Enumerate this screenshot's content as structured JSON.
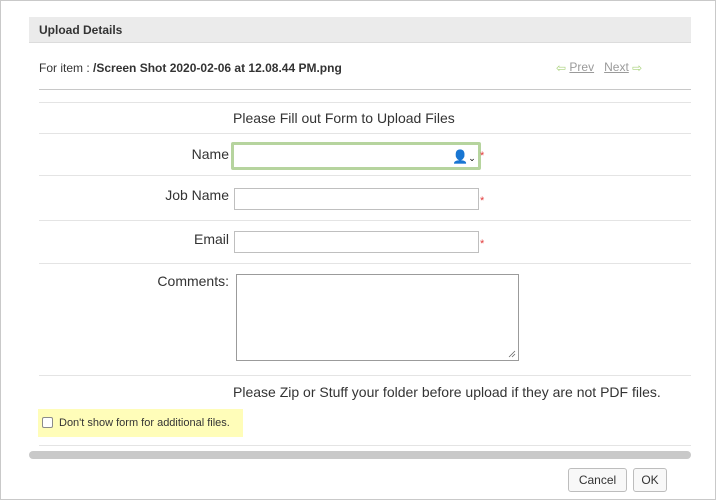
{
  "header": {
    "title": "Upload Details"
  },
  "item": {
    "prefix": "For item : ",
    "filename": "/Screen Shot 2020-02-06 at 12.08.44 PM.png"
  },
  "pager": {
    "prev_label": "Prev",
    "next_label": "Next",
    "prev_icon": "left-arrow-icon",
    "next_icon": "right-arrow-icon",
    "arrow_color": "#a8d27a"
  },
  "form": {
    "title": "Please Fill out Form to Upload Files",
    "fields": {
      "name": {
        "label": "Name",
        "value": "",
        "icon": "user-icon"
      },
      "job_name": {
        "label": "Job Name",
        "value": ""
      },
      "email": {
        "label": "Email",
        "value": ""
      },
      "comments": {
        "label": "Comments:",
        "value": ""
      }
    },
    "required_marker": "*",
    "zip_note": "Please Zip or Stuff your folder before upload if they are not PDF files.",
    "dont_show_label": "Don't show form for additional files.",
    "dont_show_checked": false,
    "focus_color": "#b6d49e",
    "highlight_color": "#fffdb9"
  },
  "buttons": {
    "cancel": "Cancel",
    "ok": "OK"
  }
}
